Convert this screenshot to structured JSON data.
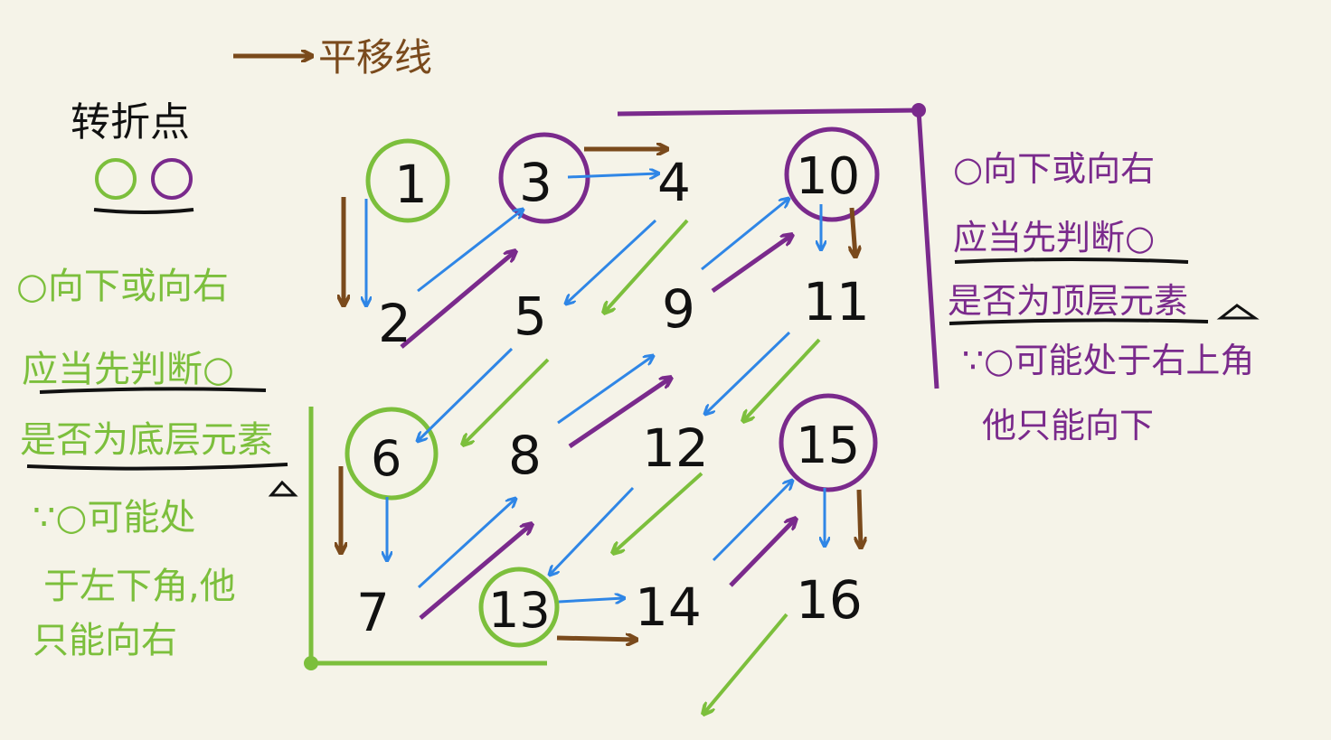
{
  "legend": {
    "translate_label": "平移线",
    "turning_point_label": "转折点"
  },
  "grid_numbers": {
    "n1": "1",
    "n2": "2",
    "n3": "3",
    "n4": "4",
    "n5": "5",
    "n6": "6",
    "n7": "7",
    "n8": "8",
    "n9": "9",
    "n10": "10",
    "n11": "11",
    "n12": "12",
    "n13": "13",
    "n14": "14",
    "n15": "15",
    "n16": "16"
  },
  "green_note": {
    "line1": "○向下或向右",
    "line2": "应当先判断○",
    "line3": "是否为底层元素",
    "line4": "∵○可能处",
    "line5": "于左下角,他",
    "line6": "只能向右"
  },
  "purple_note": {
    "line1": "○向下或向右",
    "line2": "应当先判断○",
    "line3": "是否为顶层元素",
    "line4": "∵○可能处于右上角",
    "line5": "他只能向下"
  },
  "colors": {
    "green": "#7cbf3c",
    "purple": "#7a2a8c",
    "blue": "#2f86e6",
    "brown": "#7a4a1c",
    "ink": "#111111"
  }
}
